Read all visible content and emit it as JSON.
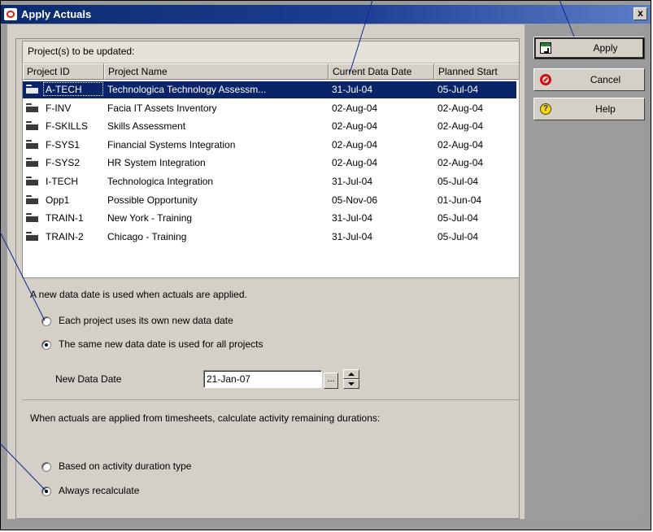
{
  "window": {
    "title": "Apply Actuals",
    "close_label": "x"
  },
  "projects": {
    "caption": "Project(s) to be updated:",
    "columns": [
      "Project ID",
      "Project Name",
      "Current Data Date",
      "Planned Start"
    ],
    "rows": [
      {
        "id": "A-TECH",
        "name": "Technologica Technology Assessm...",
        "current": "31-Jul-04",
        "planned": "05-Jul-04",
        "selected": true
      },
      {
        "id": "F-INV",
        "name": "Facia IT Assets Inventory",
        "current": "02-Aug-04",
        "planned": "02-Aug-04"
      },
      {
        "id": "F-SKILLS",
        "name": "Skills Assessment",
        "current": "02-Aug-04",
        "planned": "02-Aug-04"
      },
      {
        "id": "F-SYS1",
        "name": "Financial Systems Integration",
        "current": "02-Aug-04",
        "planned": "02-Aug-04"
      },
      {
        "id": "F-SYS2",
        "name": "HR System Integration",
        "current": "02-Aug-04",
        "planned": "02-Aug-04"
      },
      {
        "id": "I-TECH",
        "name": "Technologica Integration",
        "current": "31-Jul-04",
        "planned": "05-Jul-04"
      },
      {
        "id": "Opp1",
        "name": "Possible Opportunity",
        "current": "05-Nov-06",
        "planned": "01-Jun-04"
      },
      {
        "id": "TRAIN-1",
        "name": "New York - Training",
        "current": "31-Jul-04",
        "planned": "05-Jul-04"
      },
      {
        "id": "TRAIN-2",
        "name": "Chicago - Training",
        "current": "31-Jul-04",
        "planned": "05-Jul-04"
      }
    ]
  },
  "data_date": {
    "heading": "A new data date is used when actuals are applied.",
    "option_own": "Each project uses its own new data date",
    "option_same": "The same new data date is used for all projects",
    "selected": "same",
    "new_date_label": "New Data Date",
    "new_date_value": "21-Jan-07",
    "picker_label": "..."
  },
  "remaining": {
    "heading": "When actuals are applied from timesheets, calculate activity remaining durations:",
    "option_type": "Based on activity duration type",
    "option_recalc": "Always recalculate",
    "selected": "recalc"
  },
  "buttons": {
    "apply": "Apply",
    "cancel": "Cancel",
    "help": "Help",
    "help_glyph": "?"
  }
}
